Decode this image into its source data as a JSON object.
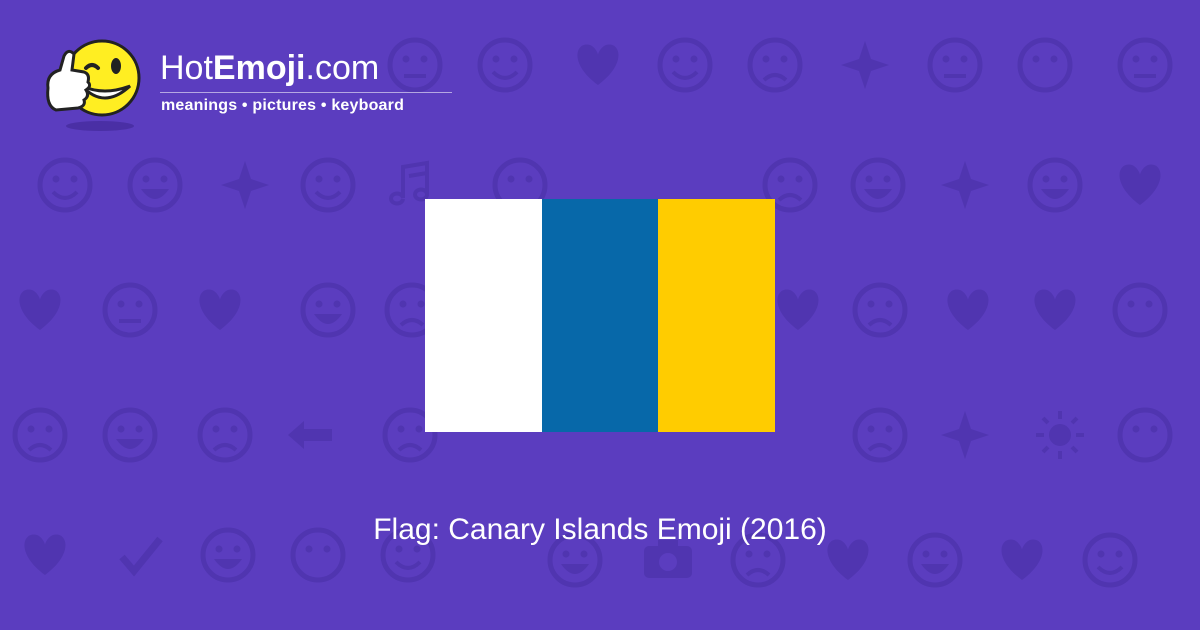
{
  "brand": {
    "name_prefix": "Hot",
    "name_bold": "Emoji",
    "name_suffix": ".com",
    "tagline": "meanings • pictures • keyboard",
    "logo_icon": "thumbs-up-wink-icon"
  },
  "flag": {
    "name": "Canary Islands",
    "stripes": [
      "#ffffff",
      "#0768a9",
      "#ffcc00"
    ]
  },
  "caption": "Flag: Canary Islands Emoji (2016)",
  "colors": {
    "background": "#5b3dbf",
    "pattern": "#5035b0",
    "text": "#ffffff"
  },
  "background_icons": [
    "relieved-face-icon",
    "kissing-face-icon",
    "winking-kissing-face-icon",
    "two-hearts-icon",
    "smiling-face-icon",
    "persevering-face-icon",
    "ok-hand-icon",
    "expressionless-face-icon",
    "eyes-icon",
    "smirking-face-icon",
    "relieved-face-icon",
    "grimacing-face-icon",
    "recycle-icon",
    "raising-hands-icon",
    "music-notes-icon",
    "monkey-icon",
    "victory-hand-icon",
    "sleeping-face-icon",
    "crying-face-icon",
    "grinning-face-icon",
    "sparkles-icon",
    "grinning-face-icon",
    "striped-heart-icon",
    "broken-heart-icon",
    "confused-face-icon",
    "striped-heart-icon",
    "tongue-face-icon",
    "worried-face-icon",
    "heart-arrow-icon",
    "weary-face-icon",
    "revolving-hearts-icon",
    "heart-icon",
    "monkey-icon",
    "screaming-face-icon",
    "devil-face-icon",
    "angry-face-icon",
    "left-arrow-icon",
    "fire-icon",
    "anguished-face-icon",
    "party-popper-icon",
    "tongue-face-icon",
    "rose-icon",
    "sun-icon",
    "flexed-biceps-icon",
    "striped-heart-icon",
    "check-mark-icon",
    "laughing-face-icon",
    "face-icon",
    "cat-face-icon",
    "waving-hand-icon",
    "mask-face-icon",
    "camera-icon",
    "frowning-face-icon",
    "striped-heart-icon",
    "grinning-face-icon",
    "heart-icon",
    "kissing-face-icon"
  ]
}
